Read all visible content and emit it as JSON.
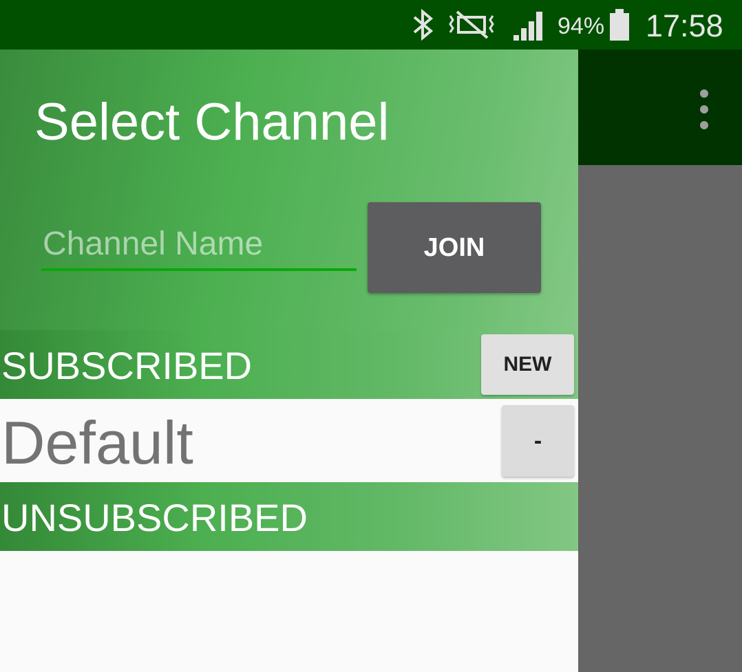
{
  "status_bar": {
    "icons": [
      "bluetooth-icon",
      "vibrate-mute-icon",
      "signal-icon",
      "battery-icon"
    ],
    "battery_percent": "94%",
    "time": "17:58",
    "color": "#005000"
  },
  "app_bar": {
    "overflow_icon": "more-vert-icon",
    "color": "#003300"
  },
  "drawer": {
    "title": "Select Channel",
    "channel_input": {
      "placeholder": "Channel Name",
      "value": ""
    },
    "join_label": "JOIN",
    "subscribed_section": {
      "label": "SUBSCRIBED",
      "new_label": "NEW",
      "channels": [
        {
          "name": "Default",
          "remove_label": "-"
        }
      ]
    },
    "unsubscribed_section": {
      "label": "UNSUBSCRIBED",
      "channels": []
    },
    "accent_color": "#4caf50",
    "input_underline_color": "#0aa80a"
  }
}
